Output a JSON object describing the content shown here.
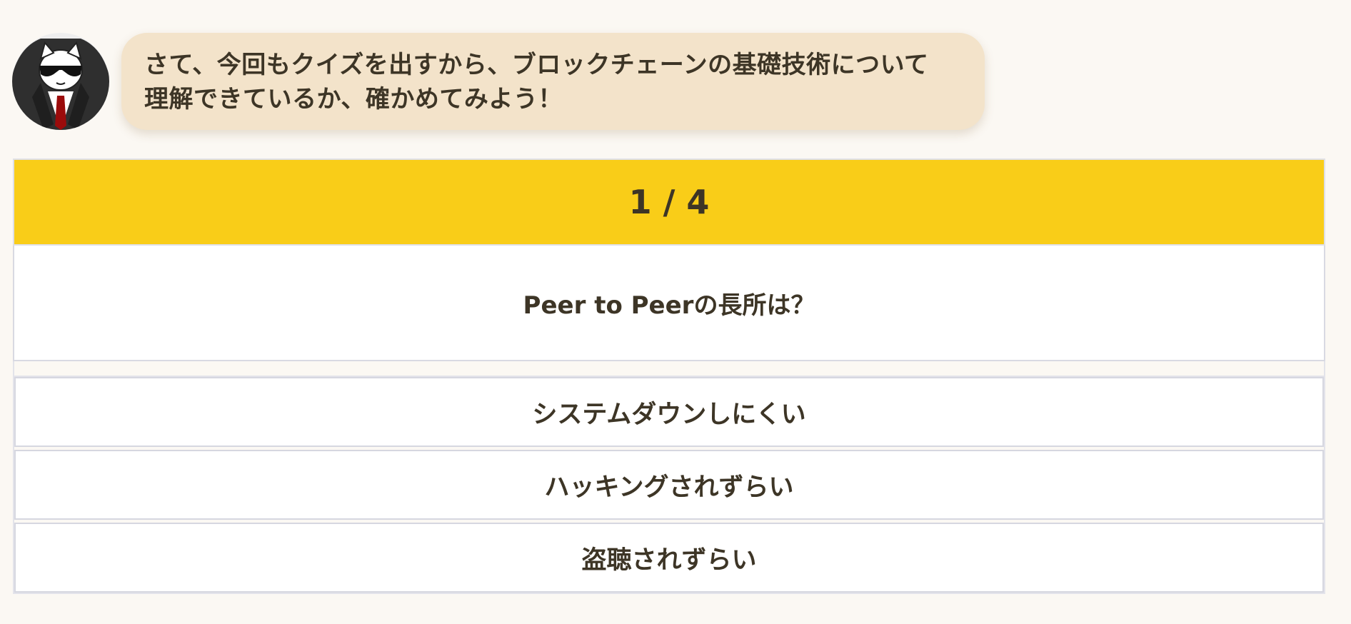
{
  "message": {
    "avatar": "cat-agent-avatar",
    "text": "さて、今回もクイズを出すから、ブロックチェーンの基礎技術について理解できているか、確かめてみよう！"
  },
  "quiz": {
    "counter": "1 / 4",
    "question": "Peer to Peerの長所は？",
    "options": [
      "システムダウンしにくい",
      "ハッキングされずらい",
      "盗聴されずらい"
    ]
  },
  "colors": {
    "page_background": "#fbf8f3",
    "bubble": "#f3e3ca",
    "counter_bar": "#f9cd18",
    "text": "#3d3526"
  }
}
